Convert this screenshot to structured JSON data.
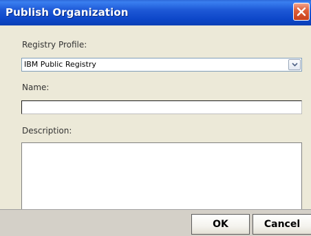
{
  "window": {
    "title": "Publish Organization"
  },
  "form": {
    "registry_profile_label": "Registry Profile:",
    "registry_profile_value": "IBM Public Registry",
    "name_label": "Name:",
    "name_value": "",
    "description_label": "Description:",
    "description_value": ""
  },
  "buttons": {
    "ok_label": "OK",
    "cancel_label": "Cancel"
  },
  "icons": {
    "close": "close-x-icon",
    "dropdown": "chevron-down-icon"
  },
  "colors": {
    "titlebar": "#0d47c9",
    "close_button": "#e0603a",
    "dialog_background": "#ece9d8"
  }
}
